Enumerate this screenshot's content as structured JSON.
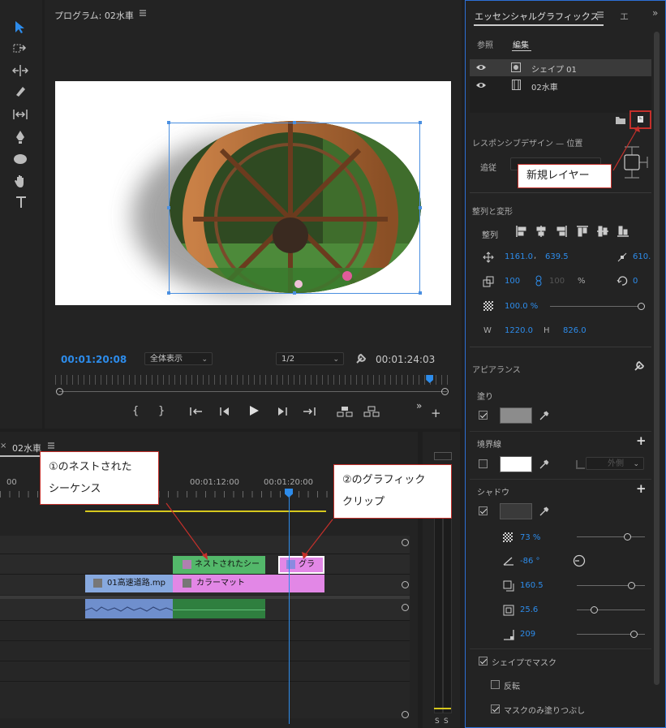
{
  "program_monitor": {
    "title": "プログラム: 02水車",
    "timecode_current": "00:01:20:08",
    "zoom": "全体表示",
    "resolution": "1/2",
    "timecode_duration": "00:01:24:03",
    "playhead_fraction": 0.95
  },
  "timeline": {
    "tab_label": "02水車",
    "ruler_labels": [
      "00",
      "00:01:12:00",
      "00:01:20:00"
    ],
    "clips": {
      "nested": "ネストされたシー",
      "graphic": "グラ",
      "highway": "01高速道路.mp",
      "matte": "カラーマット"
    },
    "meter_labels": [
      "S",
      "S"
    ]
  },
  "essential_graphics": {
    "tab_title": "エッセンシャルグラフィックス",
    "tab_next": "エ",
    "subtabs": [
      "参照",
      "編集"
    ],
    "layers": [
      "シェイプ 01",
      "02水車"
    ],
    "responsive": {
      "heading": "レスポンシブデザイン — 位置",
      "pin_label": "追従"
    },
    "align": {
      "heading": "整列と変形",
      "align_label": "整列",
      "position_x": "1161.0",
      "position_sep": ",",
      "position_y": "639.5",
      "anchor": "610.",
      "scale": "100",
      "scale_height": "100",
      "scale_unit": "%",
      "rotation": "0",
      "opacity": "100.0 %",
      "w_label": "W",
      "w_value": "1220.0",
      "h_label": "H",
      "h_value": "826.0"
    },
    "appearance": {
      "heading": "アピアランス",
      "fill_label": "塗り",
      "stroke_label": "境界線",
      "stroke_position": "外側",
      "shadow_label": "シャドウ",
      "shadow_opacity": "73 %",
      "shadow_angle": "-86 °",
      "shadow_distance": "160.5",
      "shadow_size": "25.6",
      "shadow_blur": "209",
      "mask_label": "シェイプでマスク",
      "invert_label": "反転",
      "fill_only_label": "マスクのみ塗りつぶし"
    }
  },
  "callouts": {
    "new_layer": "新規レイヤー",
    "nested_line1": "①のネストされた",
    "nested_line2": "シーケンス",
    "graphic_line1": "②のグラフィック",
    "graphic_line2": "クリップ"
  },
  "colors": {
    "accent_blue": "#2d8ceb",
    "clip_green": "#53b86a",
    "clip_pink": "#e287e6",
    "clip_blue": "#87a9df",
    "callout_red": "#c4302b"
  }
}
